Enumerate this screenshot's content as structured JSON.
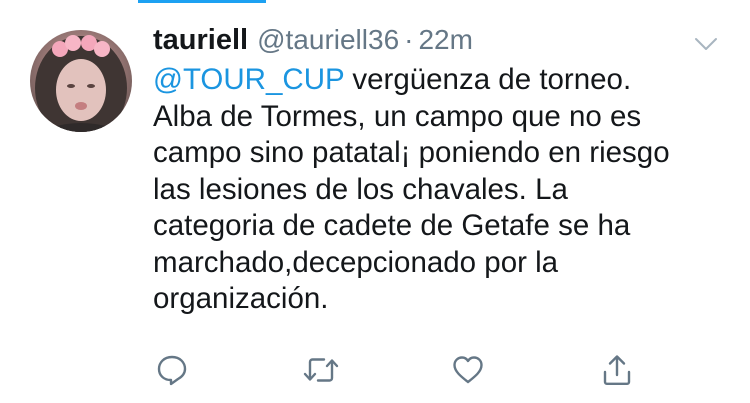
{
  "tweet": {
    "display_name": "tauriell",
    "handle": "@tauriell36",
    "separator": "·",
    "time": "22m",
    "mention": "@TOUR_CUP",
    "lines": [
      " vergüenza de torneo.",
      "Alba de Tormes, un campo que no es",
      "campo sino patatal¡ poniendo en riesgo",
      "las lesiones de los chavales. La",
      "categoria de cadete de Getafe se ha",
      "marchado,decepcionado por la",
      "organización."
    ]
  },
  "icons": {
    "more": "chevron-down-icon",
    "reply": "reply-icon",
    "retweet": "retweet-icon",
    "like": "heart-icon",
    "share": "share-icon"
  },
  "colors": {
    "accent": "#1da1f2",
    "mention": "#1b95e0",
    "secondary_text": "#657786",
    "icon": "#657786",
    "primary_text": "#14171a"
  }
}
